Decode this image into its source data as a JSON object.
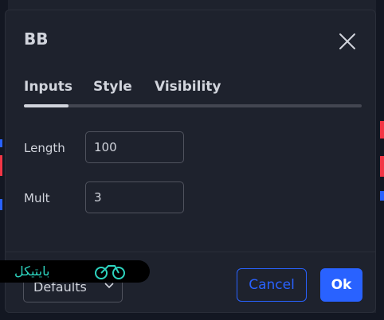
{
  "dialog": {
    "title": "BB",
    "tabs": [
      {
        "label": "Inputs",
        "active": true
      },
      {
        "label": "Style",
        "active": false
      },
      {
        "label": "Visibility",
        "active": false
      }
    ],
    "inputs": [
      {
        "label": "Length",
        "value": "100"
      },
      {
        "label": "Mult",
        "value": "3"
      }
    ],
    "footer": {
      "defaults_label": "Defaults",
      "cancel_label": "Cancel",
      "ok_label": "Ok"
    },
    "icons": {
      "close": "close-icon",
      "defaults_chevron": "chevron-down-icon"
    }
  },
  "watermark": {
    "text": "بایتیکل",
    "logo": "bicycle-logo"
  },
  "colors": {
    "background": "#1e222d",
    "text": "#d1d4dc",
    "accent": "#2962ff",
    "border": "#50535e",
    "watermark_text": "#2dd4bf"
  }
}
